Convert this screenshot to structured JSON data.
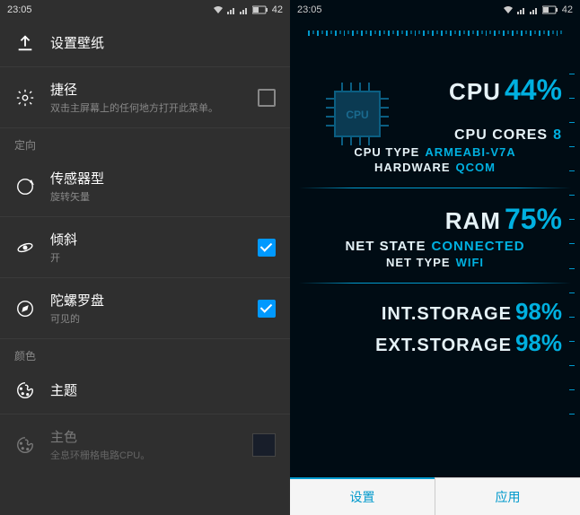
{
  "status": {
    "time": "23:05",
    "battery": "42"
  },
  "left": {
    "set_wallpaper": "设置壁纸",
    "shortcut": {
      "title": "捷径",
      "sub": "双击主屏幕上的任何地方打开此菜单。"
    },
    "orientation_header": "定向",
    "sensor": {
      "title": "传感器型",
      "sub": "旋转矢量"
    },
    "tilt": {
      "title": "倾斜",
      "sub": "开"
    },
    "gyro": {
      "title": "陀螺罗盘",
      "sub": "可见的"
    },
    "color_header": "颜色",
    "theme": {
      "title": "主题"
    },
    "primary_color": {
      "title": "主色",
      "sub": "全息环栅格电路CPU。"
    }
  },
  "right": {
    "cpu": {
      "label": "CPU",
      "value": "44%"
    },
    "cores": {
      "label": "CPU CORES",
      "value": "8"
    },
    "cputype": {
      "label": "CPU TYPE",
      "value": "ARMEABI-V7A"
    },
    "hardware": {
      "label": "HARDWARE",
      "value": "QCOM"
    },
    "ram": {
      "label": "RAM",
      "value": "75%"
    },
    "netstate": {
      "label": "NET STATE",
      "value": "CONNECTED"
    },
    "nettype": {
      "label": "NET TYPE",
      "value": "WIFI"
    },
    "intstorage": {
      "label": "INT.STORAGE",
      "value": "98%"
    },
    "extstorage": {
      "label": "EXT.STORAGE",
      "value": "98%"
    },
    "tab_settings": "设置",
    "tab_apply": "应用",
    "chip_label": "CPU"
  }
}
